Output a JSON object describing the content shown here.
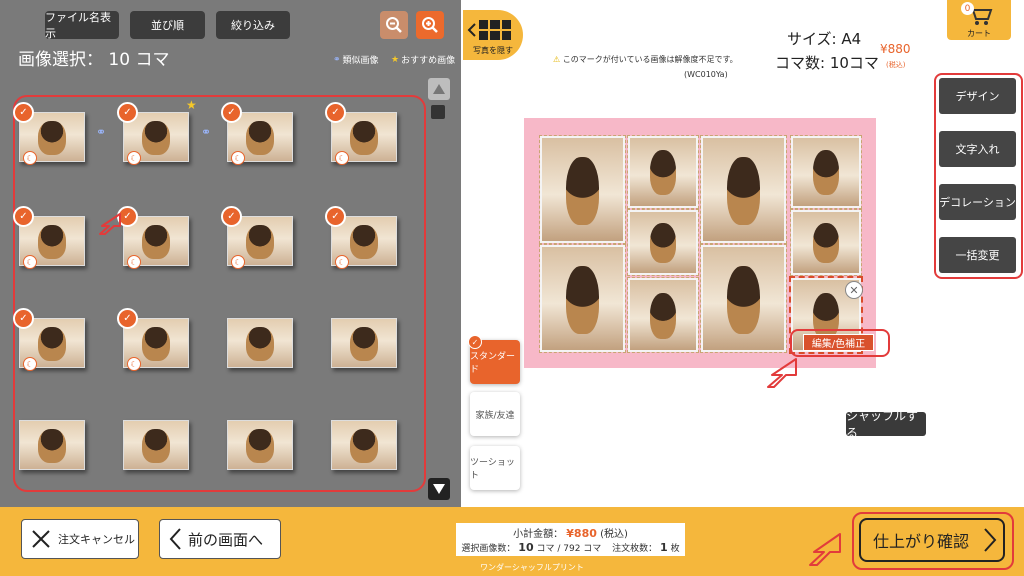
{
  "toolbar": {
    "filename_label": "ファイル名表示",
    "sort_label": "並び順",
    "filter_label": "絞り込み"
  },
  "selection": {
    "title": "画像選択：",
    "count": "10 コマ",
    "similar_label": "類似画像",
    "recommended_label": "おすすめ画像"
  },
  "right_panel": {
    "hide_photos_label": "写真を隠す",
    "warning": "このマークが付いている画像は解像度不足です。",
    "code": "(WC010Ya)",
    "size": "サイズ: A4",
    "frames": "コマ数: 10コマ",
    "price": "¥880",
    "tax_note": "(税込)",
    "cart_label": "カート",
    "cart_count": "0"
  },
  "side_buttons": [
    "デザイン",
    "文字入れ",
    "デコレーション",
    "一括変更"
  ],
  "templates": [
    "スタンダード",
    "家族/友達",
    "ツーショット"
  ],
  "edit_label": "編集/色補正",
  "shuffle_label": "シャッフルする",
  "bottom": {
    "cancel_label": "注文キャンセル",
    "back_label": "前の画面へ",
    "confirm_label": "仕上がり確認",
    "subtotal_label": "小計金額：",
    "subtotal_value": "¥880",
    "subtotal_tax": "(税込)",
    "selected_label": "選択画像数：",
    "selected_value": "10",
    "selected_total": "コマ / 792 コマ",
    "order_label": "注文枚数：",
    "order_value": "1",
    "order_unit": "枚",
    "product_name": "ワンダーシャッフルプリント"
  },
  "colors": {
    "accent": "#e8642c",
    "bar": "#f5b73c",
    "highlight": "#e23b3b"
  }
}
